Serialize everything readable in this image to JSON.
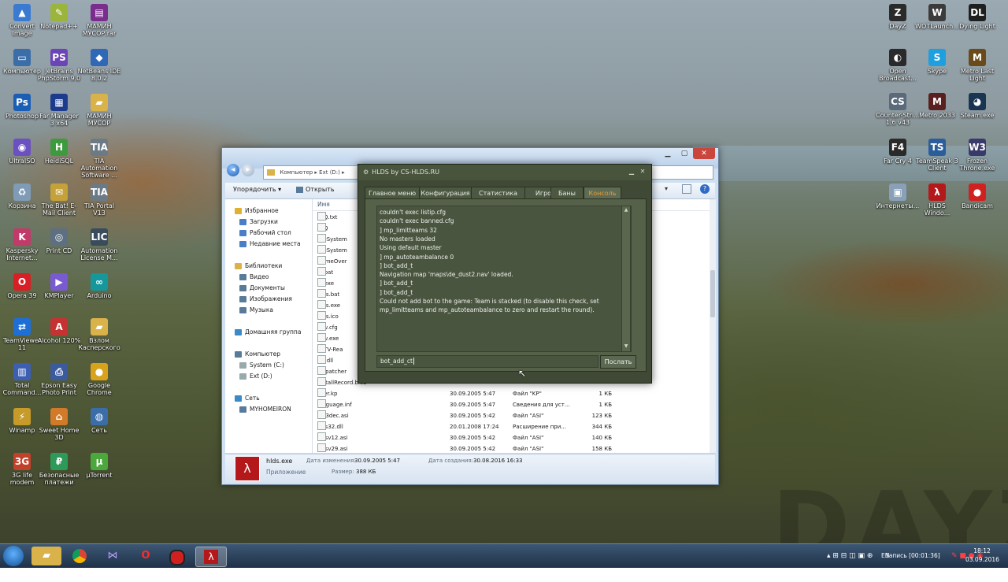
{
  "desktop": {
    "icons_left": [
      {
        "label": "Convert Image",
        "icon": "convert-image-icon",
        "color": "#3a7ad1",
        "glyph": "▲"
      },
      {
        "label": "Notepad++",
        "icon": "notepad-icon",
        "color": "#9ab43c",
        "glyph": "✎"
      },
      {
        "label": "МАМИН МУСОР.rar",
        "icon": "winrar-icon",
        "color": "#7a2d8c",
        "glyph": "▤"
      },
      {
        "label": "Компьютер",
        "icon": "computer-icon",
        "color": "#3b6ea8",
        "glyph": "▭"
      },
      {
        "label": "JetBrains PhpStorm 9.0",
        "icon": "phpstorm-icon",
        "color": "#6b45b8",
        "glyph": "PS"
      },
      {
        "label": "NetBeans IDE 8.0.2",
        "icon": "netbeans-icon",
        "color": "#2f68b6",
        "glyph": "◆"
      },
      {
        "label": "Photoshop",
        "icon": "photoshop-icon",
        "color": "#1a5fb4",
        "glyph": "Ps"
      },
      {
        "label": "Far Manager 3 x64",
        "icon": "far-manager-icon",
        "color": "#1c3b8c",
        "glyph": "▦"
      },
      {
        "label": "МАМИН МУСОР",
        "icon": "folder-icon",
        "color": "#d9b24a",
        "glyph": "▰"
      },
      {
        "label": "UltraISO",
        "icon": "ultraiso-icon",
        "color": "#6a50c0",
        "glyph": "◉"
      },
      {
        "label": "HeidiSQL",
        "icon": "heidisql-icon",
        "color": "#3e9a3e",
        "glyph": "H"
      },
      {
        "label": "TIA Automation Software ...",
        "icon": "tia-icon",
        "color": "#6c7a86",
        "glyph": "TIA"
      },
      {
        "label": "Корзина",
        "icon": "recycle-bin-icon",
        "color": "#7f9bb5",
        "glyph": "♻"
      },
      {
        "label": "The Bat! E-Mail Client",
        "icon": "thebat-icon",
        "color": "#c5a13a",
        "glyph": "✉"
      },
      {
        "label": "TIA Portal V13",
        "icon": "tia-portal-icon",
        "color": "#6c7a86",
        "glyph": "TIA"
      },
      {
        "label": "Kaspersky Internet...",
        "icon": "kaspersky-icon",
        "color": "#c23a6a",
        "glyph": "K"
      },
      {
        "label": "Print CD",
        "icon": "print-cd-icon",
        "color": "#5d6f80",
        "glyph": "◎"
      },
      {
        "label": "Automation License M...",
        "icon": "license-icon",
        "color": "#3a4b5c",
        "glyph": "LIC"
      },
      {
        "label": "Opera 39",
        "icon": "opera-icon",
        "color": "#d81f26",
        "glyph": "O"
      },
      {
        "label": "KMPlayer",
        "icon": "kmplayer-icon",
        "color": "#7a5ad0",
        "glyph": "▶"
      },
      {
        "label": "Arduino",
        "icon": "arduino-icon",
        "color": "#15979c",
        "glyph": "∞"
      },
      {
        "label": "TeamViewer 11",
        "icon": "teamviewer-icon",
        "color": "#1d6fd6",
        "glyph": "⇄"
      },
      {
        "label": "Alcohol 120%",
        "icon": "alcohol-icon",
        "color": "#c53232",
        "glyph": "A"
      },
      {
        "label": "Взлом Касперского",
        "icon": "folder-icon",
        "color": "#d9b24a",
        "glyph": "▰"
      },
      {
        "label": "Total Command...",
        "icon": "total-commander-icon",
        "color": "#3c5fb3",
        "glyph": "▥"
      },
      {
        "label": "Epson Easy Photo Print",
        "icon": "epson-icon",
        "color": "#3c5a9e",
        "glyph": "⎙"
      },
      {
        "label": "Google Chrome",
        "icon": "chrome-icon",
        "color": "#d8a21a",
        "glyph": "●"
      },
      {
        "label": "Winamp",
        "icon": "winamp-icon",
        "color": "#c79b2a",
        "glyph": "⚡"
      },
      {
        "label": "Sweet Home 3D",
        "icon": "sweethome-icon",
        "color": "#d17a2a",
        "glyph": "⌂"
      },
      {
        "label": "Сеть",
        "icon": "network-icon",
        "color": "#3b6ea8",
        "glyph": "◍"
      },
      {
        "label": "3G life modem",
        "icon": "modem-icon",
        "color": "#c2412a",
        "glyph": "3G"
      },
      {
        "label": "Безопасные платежи",
        "icon": "safe-payments-icon",
        "color": "#2e9a5a",
        "glyph": "₽"
      },
      {
        "label": "µTorrent",
        "icon": "utorrent-icon",
        "color": "#4aa83c",
        "glyph": "µ"
      }
    ],
    "icons_right": [
      {
        "label": "DayZ",
        "icon": "dayz-icon",
        "color": "#2a2a2a",
        "glyph": "Z"
      },
      {
        "label": "WOTLaunch...",
        "icon": "wot-icon",
        "color": "#3b3b3b",
        "glyph": "W"
      },
      {
        "label": "Dying Light",
        "icon": "dying-light-icon",
        "color": "#1f1f1f",
        "glyph": "DL"
      },
      {
        "label": "Open Broadcast...",
        "icon": "obs-icon",
        "color": "#2a2a2a",
        "glyph": "◐"
      },
      {
        "label": "Skype",
        "icon": "skype-icon",
        "color": "#1ea0e0",
        "glyph": "S"
      },
      {
        "label": "Metro Last Light",
        "icon": "metro-ll-icon",
        "color": "#6a4a1a",
        "glyph": "M"
      },
      {
        "label": "Counter-Stri... 1.6 v43",
        "icon": "cs-icon",
        "color": "#5a6a7a",
        "glyph": "CS"
      },
      {
        "label": "Metro 2033",
        "icon": "metro2033-icon",
        "color": "#5a1f1f",
        "glyph": "M"
      },
      {
        "label": "Steam.exe",
        "icon": "steam-icon",
        "color": "#1a3552",
        "glyph": "◕"
      },
      {
        "label": "Far Cry 4",
        "icon": "farcry-icon",
        "color": "#2a2a2a",
        "glyph": "F4"
      },
      {
        "label": "TeamSpeak 3 Client",
        "icon": "teamspeak-icon",
        "color": "#2b5d9a",
        "glyph": "TS"
      },
      {
        "label": "Frozen Throne.exe",
        "icon": "frozen-throne-icon",
        "color": "#3a3a6a",
        "glyph": "W3"
      },
      {
        "label": "Интернеты...",
        "icon": "internet-icon",
        "color": "#8aa0b8",
        "glyph": "▣"
      },
      {
        "label": "HLDS Windo...",
        "icon": "hlds-icon",
        "color": "#b4181a",
        "glyph": "λ"
      },
      {
        "label": "Bandicam",
        "icon": "bandicam-icon",
        "color": "#d02020",
        "glyph": "●"
      }
    ]
  },
  "explorer": {
    "address": "Компьютер ▸ Ext (D:) ▸",
    "toolbar": {
      "organize": "Упорядочить ▾",
      "open": "Открыть"
    },
    "nav": [
      {
        "label": "Избранное",
        "icon": "star-icon",
        "color": "#e0b030",
        "indent": 0
      },
      {
        "label": "Загрузки",
        "icon": "downloads-icon",
        "color": "#4a7fc8",
        "indent": 1
      },
      {
        "label": "Рабочий стол",
        "icon": "desktop-icon",
        "color": "#4a7fc8",
        "indent": 1
      },
      {
        "label": "Недавние места",
        "icon": "recent-icon",
        "color": "#4a7fc8",
        "indent": 1
      },
      {
        "label": "Библиотеки",
        "icon": "library-icon",
        "color": "#d9b24a",
        "indent": 0
      },
      {
        "label": "Видео",
        "icon": "video-icon",
        "color": "#5a7a9a",
        "indent": 1
      },
      {
        "label": "Документы",
        "icon": "documents-icon",
        "color": "#5a7a9a",
        "indent": 1
      },
      {
        "label": "Изображения",
        "icon": "pictures-icon",
        "color": "#5a7a9a",
        "indent": 1
      },
      {
        "label": "Музыка",
        "icon": "music-icon",
        "color": "#5a7a9a",
        "indent": 1
      },
      {
        "label": "Домашняя группа",
        "icon": "homegroup-icon",
        "color": "#3a8ac8",
        "indent": 0
      },
      {
        "label": "Компьютер",
        "icon": "computer-icon",
        "color": "#5a7a9a",
        "indent": 0
      },
      {
        "label": "System (C:)",
        "icon": "drive-icon",
        "color": "#9aa",
        "indent": 1
      },
      {
        "label": "Ext (D:)",
        "icon": "drive-icon",
        "color": "#9aa",
        "indent": 1
      },
      {
        "label": "Сеть",
        "icon": "network-icon",
        "color": "#3a8ac8",
        "indent": 0
      },
      {
        "label": "MYHOMEIRON",
        "icon": "pc-icon",
        "color": "#5a7a9a",
        "indent": 1
      }
    ],
    "column_name": "Имя",
    "files": [
      {
        "name": "FAQ.txt",
        "date": "",
        "type": "",
        "size": ""
      },
      {
        "name": "FAQ",
        "date": "",
        "type": "",
        "size": ""
      },
      {
        "name": "FileSystem",
        "date": "",
        "type": "",
        "size": ""
      },
      {
        "name": "FileSystem",
        "date": "",
        "type": "",
        "size": ""
      },
      {
        "name": "GameOver",
        "date": "",
        "type": "",
        "size": ""
      },
      {
        "name": "hl.bat",
        "date": "",
        "type": "",
        "size": ""
      },
      {
        "name": "hl.exe",
        "date": "",
        "type": "",
        "size": ""
      },
      {
        "name": "hlds.bat",
        "date": "",
        "type": "",
        "size": ""
      },
      {
        "name": "hlds.exe",
        "date": "",
        "type": "",
        "size": ""
      },
      {
        "name": "hlds.ico",
        "date": "",
        "type": "",
        "size": ""
      },
      {
        "name": "hltv.cfg",
        "date": "",
        "type": "",
        "size": ""
      },
      {
        "name": "hltv.exe",
        "date": "",
        "type": "",
        "size": ""
      },
      {
        "name": "HLTV-Rea",
        "date": "",
        "type": "",
        "size": ""
      },
      {
        "name": "hw.dll",
        "date": "",
        "type": "",
        "size": ""
      },
      {
        "name": "hwpatcher",
        "date": "",
        "type": "",
        "size": ""
      },
      {
        "name": "InstallRecord.blob",
        "date": "",
        "type": "",
        "size": ""
      },
      {
        "name": "kver.kp",
        "date": "30.09.2005 5:47",
        "type": "Файл \"KP\"",
        "size": "1 КБ"
      },
      {
        "name": "language.inf",
        "date": "30.09.2005 5:47",
        "type": "Сведения для уст...",
        "size": "1 КБ"
      },
      {
        "name": "Mp3dec.asi",
        "date": "30.09.2005 5:42",
        "type": "Файл \"ASI\"",
        "size": "123 КБ"
      },
      {
        "name": "Mss32.dll",
        "date": "20.01.2008 17:24",
        "type": "Расширение при...",
        "size": "344 КБ"
      },
      {
        "name": "Mssv12.asi",
        "date": "30.09.2005 5:42",
        "type": "Файл \"ASI\"",
        "size": "140 КБ"
      },
      {
        "name": "Mssv29.asi",
        "date": "30.09.2005 5:42",
        "type": "Файл \"ASI\"",
        "size": "158 КБ"
      }
    ],
    "details": {
      "name": "hlds.exe",
      "kind": "Приложение",
      "modified_label": "Дата изменения:",
      "modified": "30.09.2005 5:47",
      "size_label": "Размер:",
      "size": "388 КБ",
      "created_label": "Дата создания:",
      "created": "30.08.2016 16:33"
    }
  },
  "hlds": {
    "title": "HLDS by CS-HLDS.RU",
    "tabs": [
      {
        "label": "Главное меню",
        "active": false
      },
      {
        "label": "Конфигурация",
        "active": false
      },
      {
        "label": "Статистика",
        "active": false
      },
      {
        "label": "Игроки",
        "active": false
      },
      {
        "label": "Баны",
        "active": false
      },
      {
        "label": "Консоль",
        "active": true
      }
    ],
    "console_lines": [
      "couldn't exec listip.cfg",
      "couldn't exec banned.cfg",
      "] mp_limitteams 32",
      "No masters loaded",
      "Using default master",
      "] mp_autoteambalance 0",
      "] bot_add_t",
      "Navigation map 'maps\\de_dust2.nav' loaded.",
      "] bot_add_t",
      "] bot_add_t",
      "Could not add bot to the game: Team is stacked (to disable this check, set",
      "mp_limitteams and mp_autoteambalance to zero and restart the round)."
    ],
    "command_value": "bot_add_ct",
    "send_label": "Послать"
  },
  "taskbar": {
    "lang": "EN",
    "recording": "Запись [00:01:36]",
    "time": "18:12",
    "date": "03.09.2016"
  }
}
